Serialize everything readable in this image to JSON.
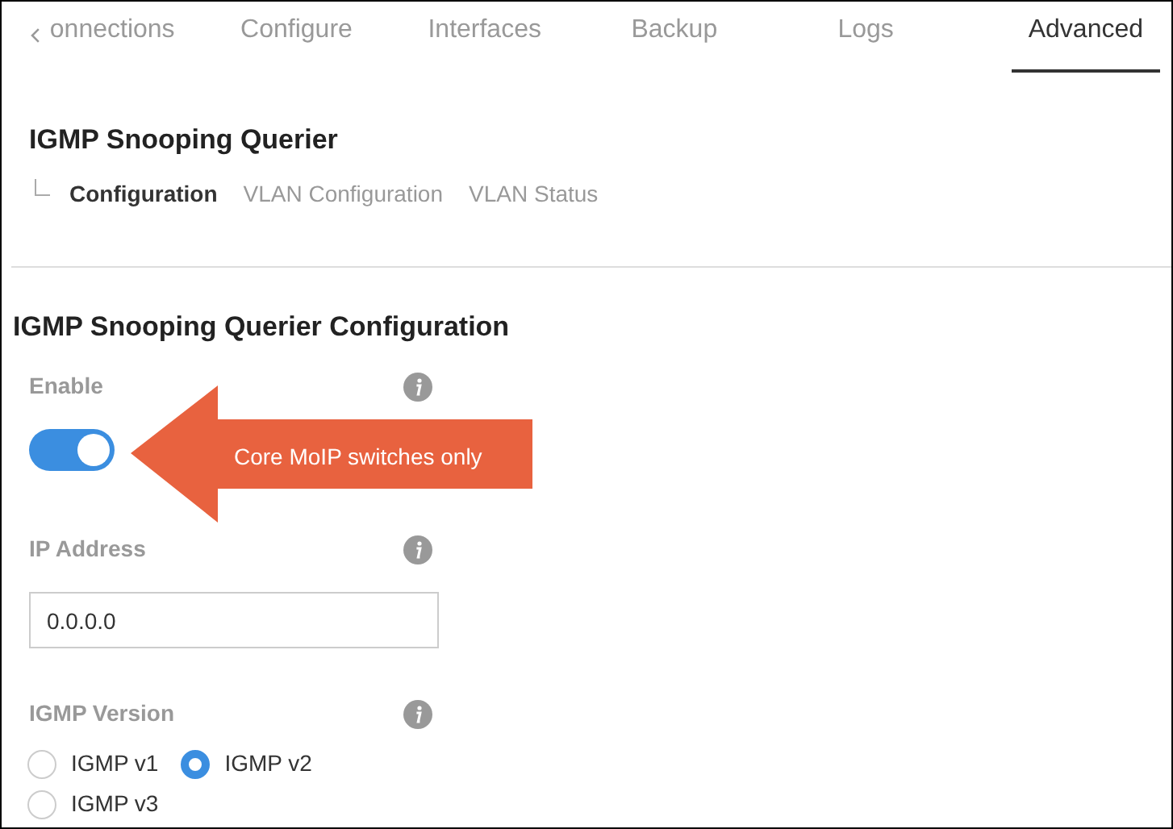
{
  "tabs": [
    {
      "label": "onnections",
      "selected": false
    },
    {
      "label": "Configure",
      "selected": false
    },
    {
      "label": "Interfaces",
      "selected": false
    },
    {
      "label": "Backup",
      "selected": false
    },
    {
      "label": "Logs",
      "selected": false
    },
    {
      "label": "Advanced",
      "selected": true
    }
  ],
  "page_title": "IGMP Snooping Querier",
  "subnav": [
    {
      "label": "Configuration",
      "selected": true
    },
    {
      "label": "VLAN Configuration",
      "selected": false
    },
    {
      "label": "VLAN Status",
      "selected": false
    }
  ],
  "section_title": "IGMP Snooping Querier Configuration",
  "enable": {
    "label": "Enable",
    "on": true
  },
  "callout": "Core MoIP switches only",
  "ip_address": {
    "label": "IP Address",
    "value": "0.0.0.0"
  },
  "igmp_version": {
    "label": "IGMP Version",
    "options": [
      {
        "label": "IGMP v1",
        "selected": false
      },
      {
        "label": "IGMP v2",
        "selected": true
      },
      {
        "label": "IGMP v3",
        "selected": false
      }
    ]
  }
}
